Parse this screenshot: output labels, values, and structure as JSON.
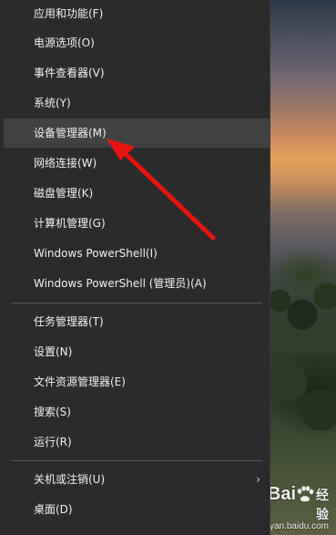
{
  "menu": {
    "items": [
      {
        "label": "应用和功能(F)"
      },
      {
        "label": "电源选项(O)"
      },
      {
        "label": "事件查看器(V)"
      },
      {
        "label": "系统(Y)"
      },
      {
        "label": "设备管理器(M)"
      },
      {
        "label": "网络连接(W)"
      },
      {
        "label": "磁盘管理(K)"
      },
      {
        "label": "计算机管理(G)"
      },
      {
        "label": "Windows PowerShell(I)"
      },
      {
        "label": "Windows PowerShell (管理员)(A)"
      },
      {
        "label": "任务管理器(T)"
      },
      {
        "label": "设置(N)"
      },
      {
        "label": "文件资源管理器(E)"
      },
      {
        "label": "搜索(S)"
      },
      {
        "label": "运行(R)"
      },
      {
        "label": "关机或注销(U)"
      },
      {
        "label": "桌面(D)"
      }
    ],
    "highlighted_label": "设备管理器(M)",
    "submenu_arrow": "›"
  },
  "annotation": {
    "arrow_color": "#e8140f"
  },
  "watermark": {
    "brand": "Bai",
    "brand_suffix": "经验",
    "url": "jingyan.baidu.com"
  }
}
